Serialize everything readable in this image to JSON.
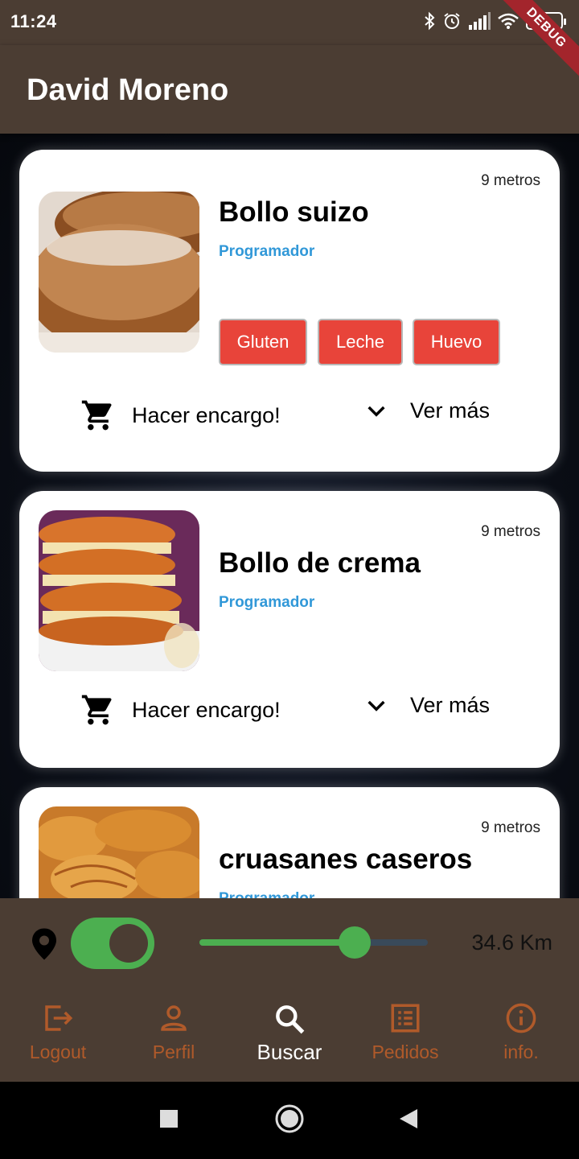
{
  "status_bar": {
    "time": "11:24",
    "battery": "51"
  },
  "debug_banner": "DEBUG",
  "app_bar": {
    "title": "David Moreno"
  },
  "cards": [
    {
      "distance": "9 metros",
      "title": "Bollo suizo",
      "role": "Programador",
      "allergens": [
        "Gluten",
        "Leche",
        "Huevo"
      ],
      "order_label": "Hacer encargo!",
      "more_label": "Ver más"
    },
    {
      "distance": "9 metros",
      "title": "Bollo de crema",
      "role": "Programador",
      "allergens": [],
      "order_label": "Hacer encargo!",
      "more_label": "Ver más"
    },
    {
      "distance": "9 metros",
      "title": "cruasanes caseros",
      "role": "Programador",
      "allergens": [],
      "order_label": "",
      "more_label": ""
    }
  ],
  "controls": {
    "location_enabled": true,
    "distance_fraction": 0.68,
    "distance_label": "34.6 Km"
  },
  "bottom_nav": [
    {
      "label": "Logout",
      "icon": "logout-icon",
      "active": false
    },
    {
      "label": "Perfil",
      "icon": "person-icon",
      "active": false
    },
    {
      "label": "Buscar",
      "icon": "search-icon",
      "active": true
    },
    {
      "label": "Pedidos",
      "icon": "list-icon",
      "active": false
    },
    {
      "label": "info.",
      "icon": "info-icon",
      "active": false
    }
  ],
  "colors": {
    "bar_brown": "#4b3d33",
    "allergen_red": "#e8443a",
    "role_blue": "#3198d8",
    "toggle_green": "#4caf50",
    "nav_inactive": "#b05a2a"
  }
}
